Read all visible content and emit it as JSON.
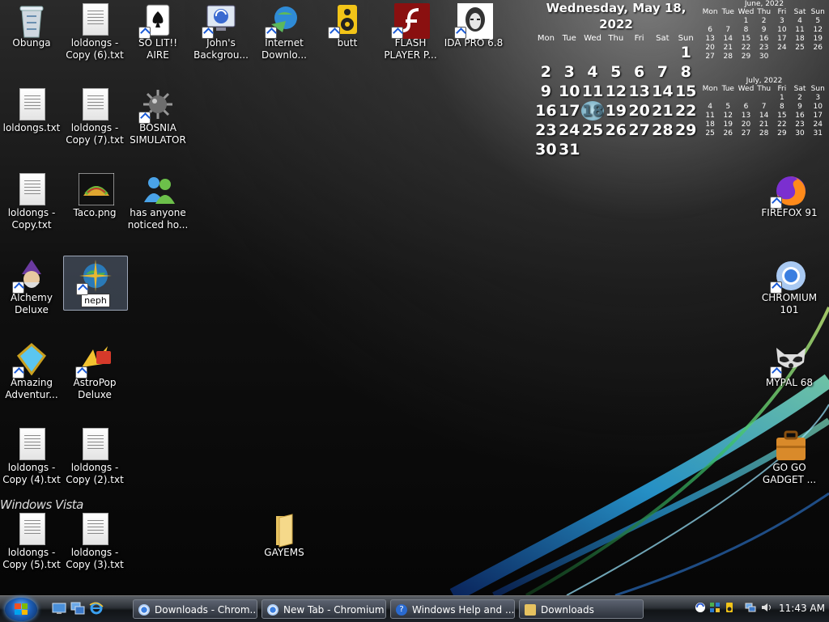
{
  "desktop_icons": {
    "recycle": "Obunga",
    "txt_copy6": "loldongs -\nCopy (6).txt",
    "solitaire": "SO LIT!! AIRE",
    "johns_bg": "John's\nBackgrou...",
    "idm": "Internet\nDownlo...",
    "butt": "butt",
    "flash": "FLASH\nPLAYER P...",
    "ida": "IDA PRO 6.8",
    "txt_main": "loldongs.txt",
    "txt_copy7": "loldongs -\nCopy (7).txt",
    "bosnia": "BOSNIA\nSIMULATOR",
    "txt_copy": "loldongs -\nCopy.txt",
    "taco": "Taco.png",
    "has_anyone": "has anyone\nnoticed ho...",
    "alchemy": "Alchemy\nDeluxe",
    "neph_rename": "neph",
    "amazing": "Amazing\nAdventur...",
    "astropop": "AstroPop\nDeluxe",
    "txt_copy4": "loldongs -\nCopy (4).txt",
    "txt_copy2": "loldongs -\nCopy (2).txt",
    "txt_copy5": "loldongs -\nCopy (5).txt",
    "txt_copy3": "loldongs -\nCopy (3).txt",
    "gayems": "GAYEMS",
    "firefox": "FIREFOX 91",
    "chromium": "CHROMIUM\n101",
    "mypal": "MYPAL 68",
    "gogo": "GO GO\nGADGET ..."
  },
  "watermark": "Windows Vista",
  "calendar_main": {
    "title": "Wednesday, May 18, 2022",
    "days_of_week": [
      "Mon",
      "Tue",
      "Wed",
      "Thu",
      "Fri",
      "Sat",
      "Sun"
    ],
    "weeks": [
      [
        "",
        "",
        "",
        "",
        "",
        "",
        "1"
      ],
      [
        "2",
        "3",
        "4",
        "5",
        "6",
        "7",
        "8"
      ],
      [
        "9",
        "10",
        "11",
        "12",
        "13",
        "14",
        "15"
      ],
      [
        "16",
        "17",
        "18",
        "19",
        "20",
        "21",
        "22"
      ],
      [
        "23",
        "24",
        "25",
        "26",
        "27",
        "28",
        "29"
      ],
      [
        "30",
        "31",
        "",
        "",
        "",
        "",
        ""
      ]
    ],
    "today": "18"
  },
  "calendar_june": {
    "title": "June, 2022",
    "days_of_week": [
      "Mon",
      "Tue",
      "Wed",
      "Thu",
      "Fri",
      "Sat",
      "Sun"
    ],
    "weeks": [
      [
        "",
        "",
        "1",
        "2",
        "3",
        "4",
        "5"
      ],
      [
        "6",
        "7",
        "8",
        "9",
        "10",
        "11",
        "12"
      ],
      [
        "13",
        "14",
        "15",
        "16",
        "17",
        "18",
        "19"
      ],
      [
        "20",
        "21",
        "22",
        "23",
        "24",
        "25",
        "26"
      ],
      [
        "27",
        "28",
        "29",
        "30",
        "",
        "",
        ""
      ]
    ]
  },
  "calendar_july": {
    "title": "July, 2022",
    "days_of_week": [
      "Mon",
      "Tue",
      "Wed",
      "Thu",
      "Fri",
      "Sat",
      "Sun"
    ],
    "weeks": [
      [
        "",
        "",
        "",
        "",
        "1",
        "2",
        "3"
      ],
      [
        "4",
        "5",
        "6",
        "7",
        "8",
        "9",
        "10"
      ],
      [
        "11",
        "12",
        "13",
        "14",
        "15",
        "16",
        "17"
      ],
      [
        "18",
        "19",
        "20",
        "21",
        "22",
        "23",
        "24"
      ],
      [
        "25",
        "26",
        "27",
        "28",
        "29",
        "30",
        "31"
      ]
    ]
  },
  "taskbar": {
    "tasks": [
      {
        "label": "Downloads - Chrom...",
        "icon": "chromium-icon"
      },
      {
        "label": "New Tab - Chromium",
        "icon": "chromium-icon"
      },
      {
        "label": "Windows Help and ...",
        "icon": "help-icon"
      },
      {
        "label": "Downloads",
        "icon": "folder-icon"
      }
    ],
    "clock": "11:43 AM"
  }
}
